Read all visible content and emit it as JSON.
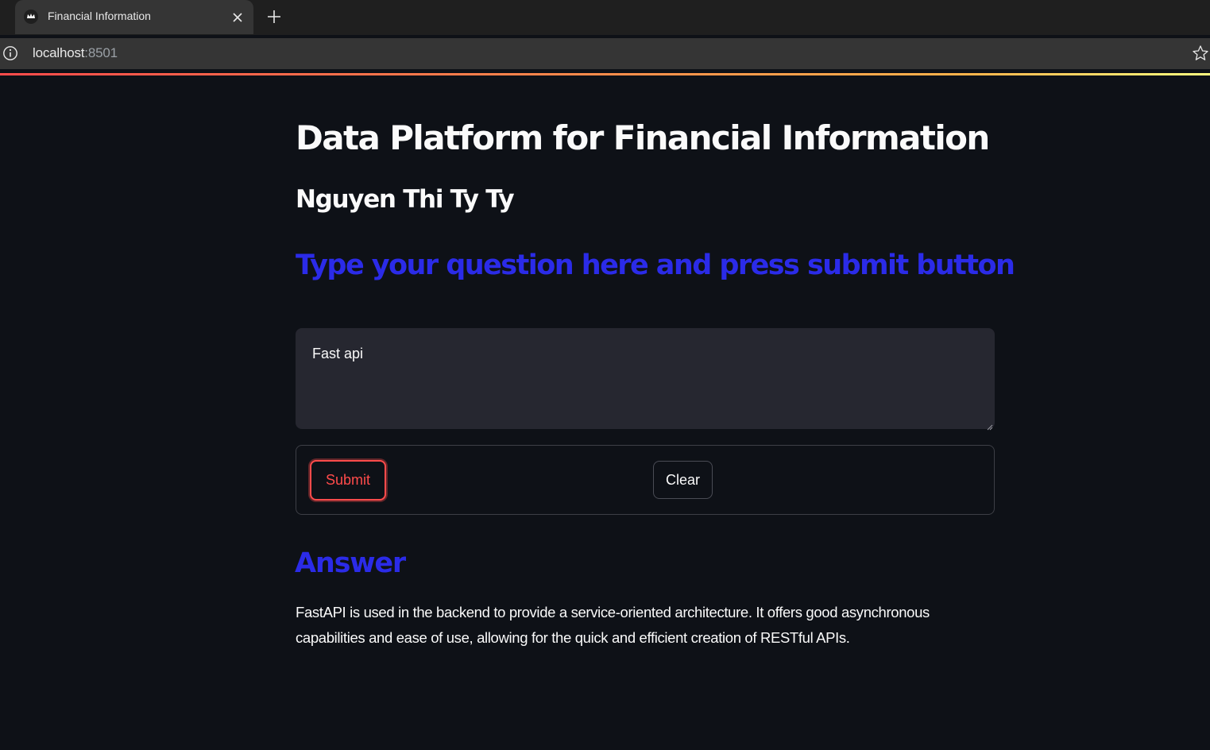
{
  "browser": {
    "tab_title": "Financial Information",
    "url_host": "localhost",
    "url_port": ":8501"
  },
  "app": {
    "title": "Data Platform for Financial Information",
    "author": "Nguyen Thi Ty Ty",
    "prompt_heading": "Type your question here and press submit button",
    "question_value": "Fast api",
    "submit_label": "Submit",
    "clear_label": "Clear",
    "answer_heading": "Answer",
    "answer_text": "FastAPI is used in the backend to provide a service-oriented architecture. It offers good asynchronous capabilities and ease of use, allowing for the quick and efficient creation of RESTful APIs."
  },
  "colors": {
    "background": "#0e1117",
    "accent_blue": "#2b2be8",
    "submit_red": "#ff4b4b",
    "input_bg": "#262730"
  },
  "icons": {
    "favicon": "streamlit-crown-icon",
    "tab_close": "close-icon",
    "new_tab": "plus-icon",
    "site_info": "info-icon",
    "bookmark": "star-icon"
  }
}
